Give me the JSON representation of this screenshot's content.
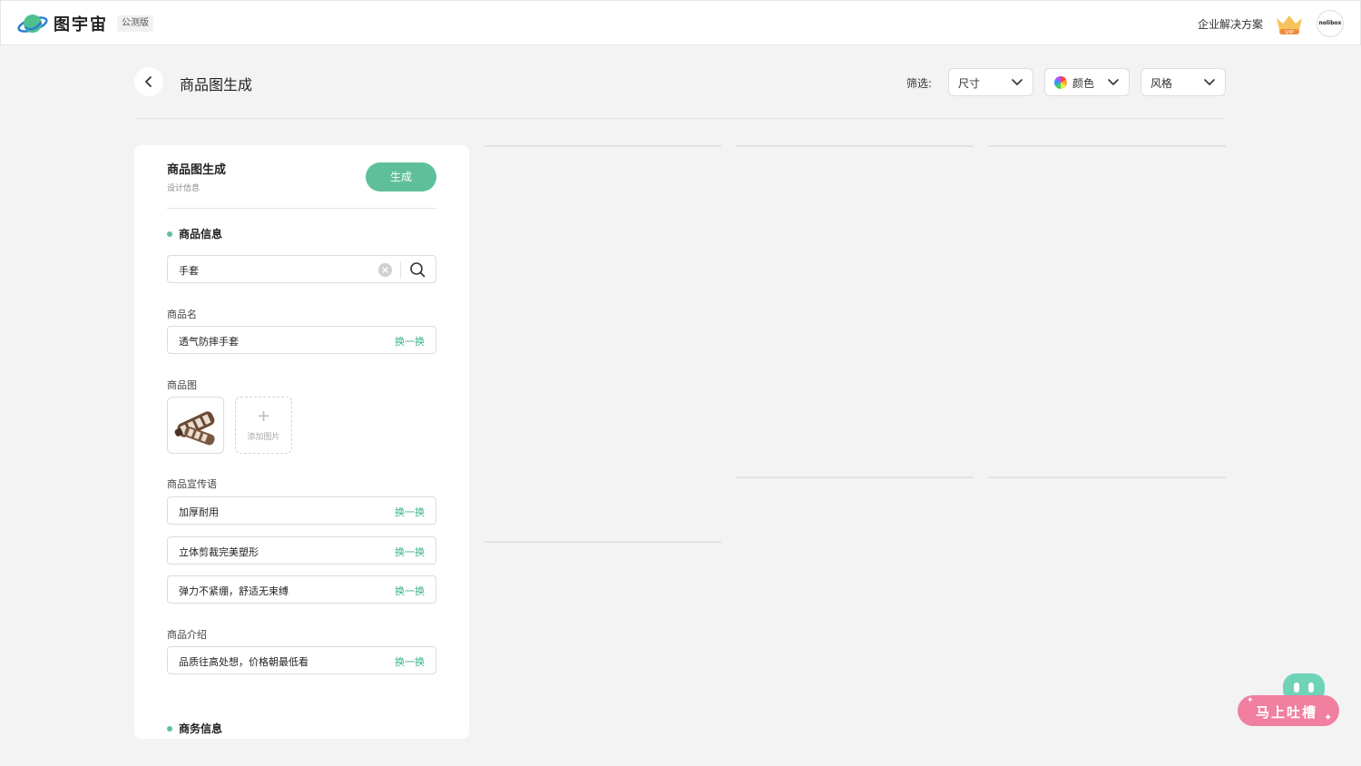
{
  "header": {
    "brand": "图宇宙",
    "badge": "公测版",
    "enterprise_link": "企业解决方案",
    "vip_label": "VIP",
    "avatar_text": "nolibox",
    "logo_icon": "planet-logo-icon"
  },
  "page": {
    "title": "商品图生成",
    "filter_label": "筛选:",
    "filters": [
      {
        "label": "尺寸"
      },
      {
        "label": "颜色"
      },
      {
        "label": "风格"
      }
    ]
  },
  "panel": {
    "title": "商品图生成",
    "subtitle": "设计信息",
    "generate_label": "生成",
    "product_section": "商品信息",
    "search_value": "手套",
    "name_label": "商品名",
    "name_value": "透气防摔手套",
    "swap_label": "换一换",
    "image_label": "商品图",
    "add_image_label": "添加图片",
    "slogan_label": "商品宣传语",
    "slogans": [
      "加厚耐用",
      "立体剪裁完美塑形",
      "弹力不紧绷，舒适无束缚"
    ],
    "intro_label": "商品介绍",
    "intro_value": "品质往高处想，价格朝最低看",
    "business_section": "商务信息"
  },
  "feedback": {
    "label": "马上吐槽"
  },
  "colors": {
    "accent": "#5fbf9b",
    "accent_text": "#3bb08a",
    "feedback_pink": "#f07fa0",
    "feedback_teal": "#6fd3b8"
  }
}
